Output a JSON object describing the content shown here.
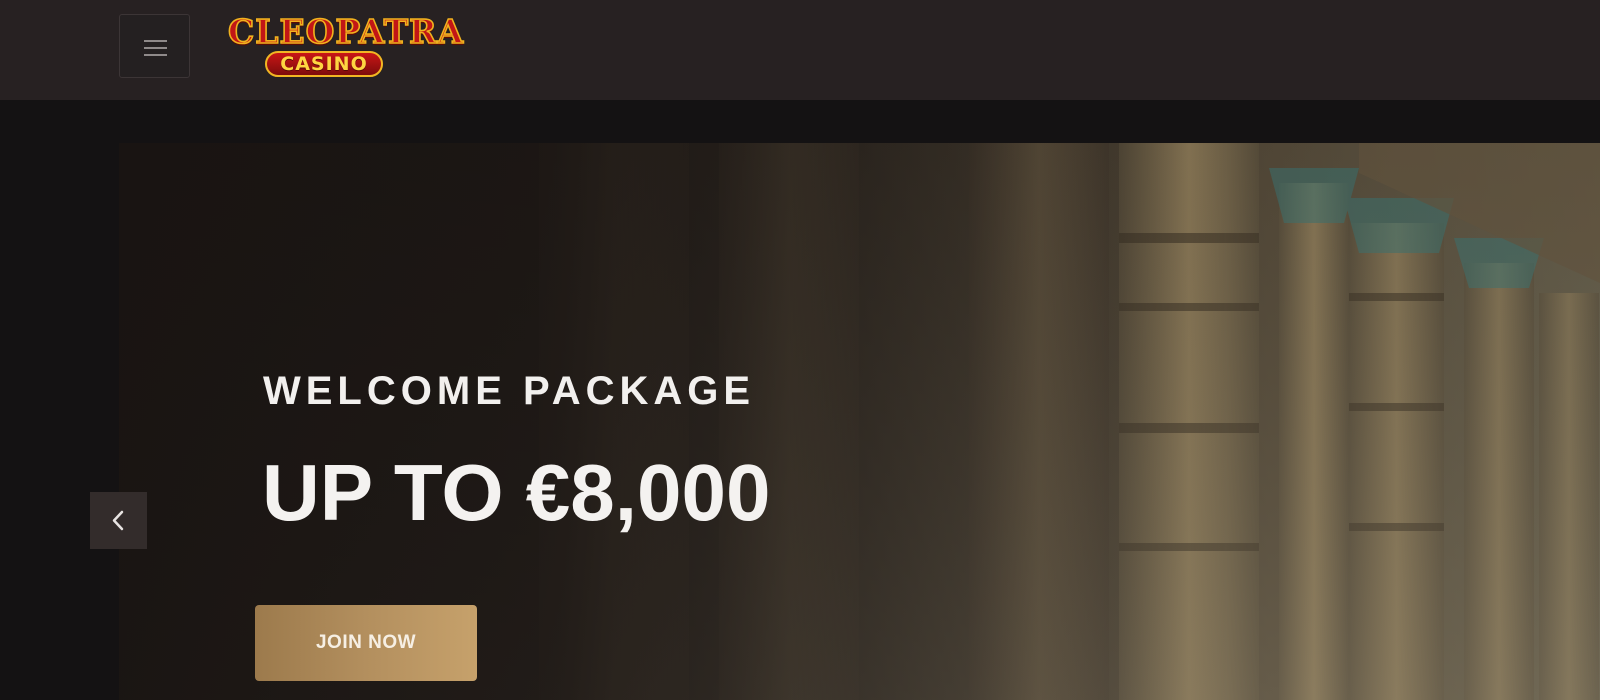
{
  "header": {
    "menu_icon": "hamburger-menu-icon",
    "logo": {
      "top_text": "CLEOPATRA",
      "bottom_text": "CASINO",
      "colors": {
        "red": "#c21616",
        "gold": "#f0b21e"
      }
    }
  },
  "hero": {
    "subtitle": "WELCOME PACKAGE",
    "title": "UP TO €8,000",
    "cta_label": "JOIN NOW",
    "prev_icon": "chevron-left-icon",
    "background": "egyptian-temple-columns",
    "colors": {
      "cta_gold": "#b38f5e",
      "text": "#f4f2f0"
    }
  }
}
